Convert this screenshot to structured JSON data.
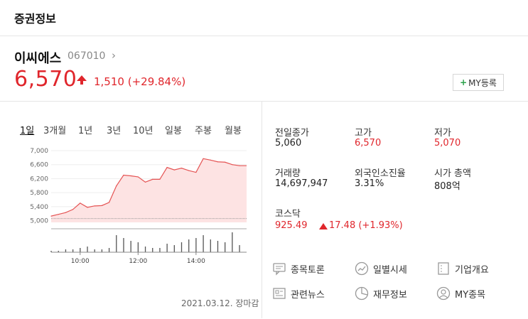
{
  "header": {
    "title": "증권정보"
  },
  "stock": {
    "name": "이씨에스",
    "code": "067010",
    "price": "6,570",
    "change": "1,510",
    "change_pct": "(+29.84%)",
    "my_button": "MY등록"
  },
  "chart": {
    "tabs": [
      "1일",
      "3개월",
      "1년",
      "3년",
      "10년",
      "일봉",
      "주봉",
      "월봉"
    ],
    "y_ticks": [
      "7,000",
      "6,600",
      "6,200",
      "5,800",
      "5,400",
      "5,000"
    ],
    "x_ticks": [
      "10:00",
      "12:00",
      "14:00"
    ],
    "date": "2021.03.12. 장마감"
  },
  "stats": {
    "prev_close_label": "전일종가",
    "prev_close": "5,060",
    "high_label": "고가",
    "high": "6,570",
    "low_label": "저가",
    "low": "5,070",
    "volume_label": "거래량",
    "volume": "14,697,947",
    "foreign_label": "외국인소진율",
    "foreign": "3.31%",
    "mcap_label": "시가 총액",
    "mcap": "808억",
    "index_label": "코스닥",
    "index_value": "925.49",
    "index_change": "17.48 (+1.93%)"
  },
  "links": {
    "discussion": "종목토론",
    "daily": "일별시세",
    "company": "기업개요",
    "news": "관련뉴스",
    "finance": "재무정보",
    "my_stocks": "MY종목"
  },
  "chart_data": {
    "type": "line",
    "title": "",
    "xlabel": "",
    "ylabel": "",
    "ylim": [
      4950,
      7000
    ],
    "y_ticks": [
      7000,
      6600,
      6200,
      5800,
      5400,
      5000
    ],
    "reference": 5060,
    "x": [
      "09:00",
      "09:15",
      "09:30",
      "09:45",
      "10:00",
      "10:15",
      "10:30",
      "10:45",
      "11:00",
      "11:15",
      "11:30",
      "11:45",
      "12:00",
      "12:15",
      "12:30",
      "12:45",
      "13:00",
      "13:15",
      "13:30",
      "13:45",
      "14:00",
      "14:15",
      "14:30",
      "14:45",
      "15:00",
      "15:15",
      "15:20"
    ],
    "values": [
      5130,
      5180,
      5230,
      5320,
      5500,
      5380,
      5420,
      5430,
      5520,
      5990,
      6300,
      6280,
      6250,
      6100,
      6180,
      6180,
      6520,
      6450,
      6500,
      6430,
      6380,
      6770,
      6730,
      6680,
      6670,
      6600,
      6570
    ],
    "volume": [
      1,
      1,
      2,
      2,
      3,
      4,
      2,
      2,
      3,
      12,
      10,
      8,
      7,
      4,
      3,
      3,
      6,
      5,
      7,
      9,
      10,
      12,
      9,
      8,
      7,
      14,
      5
    ]
  }
}
